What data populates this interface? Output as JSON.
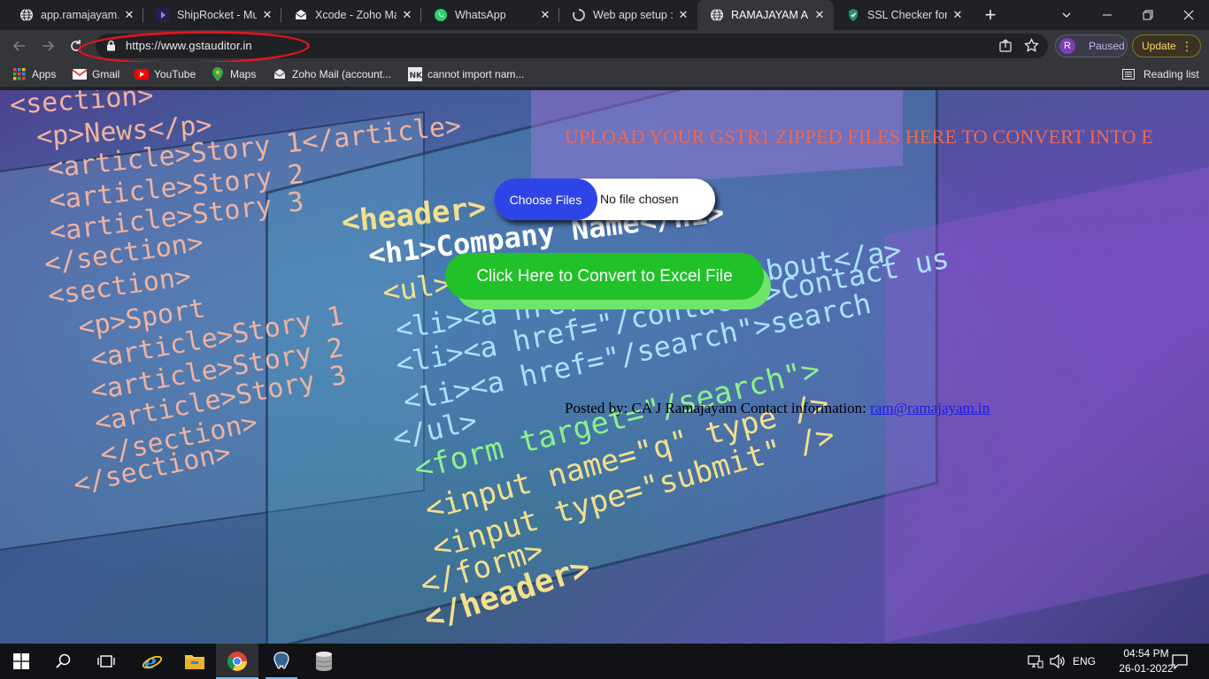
{
  "browser": {
    "tabs": [
      {
        "title": "app.ramajayam.in",
        "icon": "globe-icon",
        "active": false
      },
      {
        "title": "ShipRocket - Mul",
        "icon": "shiprocket-icon",
        "active": false
      },
      {
        "title": "Xcode - Zoho Ma",
        "icon": "zoho-mail-icon",
        "active": false
      },
      {
        "title": "WhatsApp",
        "icon": "whatsapp-icon",
        "active": false
      },
      {
        "title": "Web app setup :",
        "icon": "loading-icon",
        "active": false
      },
      {
        "title": "RAMAJAYAM AN",
        "icon": "globe-icon",
        "active": true
      },
      {
        "title": "SSL Checker for C",
        "icon": "ssl-checker-icon",
        "active": false
      }
    ],
    "new_tab_symbol": "+",
    "url": "https://www.gstauditor.in",
    "profile": {
      "initial": "R",
      "label": "Paused"
    },
    "update_label": "Update",
    "bookmarks": [
      {
        "label": "Apps",
        "icon": "apps-grid-icon"
      },
      {
        "label": "Gmail",
        "icon": "gmail-icon"
      },
      {
        "label": "YouTube",
        "icon": "youtube-icon"
      },
      {
        "label": "Maps",
        "icon": "maps-icon"
      },
      {
        "label": "Zoho Mail (account...",
        "icon": "zoho-mail-icon"
      },
      {
        "label": "cannot import nam...",
        "icon": "nk-icon"
      }
    ],
    "reading_list": "Reading list"
  },
  "page": {
    "heading": "UPLOAD YOUR GSTR1 ZIPPED FILES HERE TO CONVERT INTO E",
    "file_button": "Choose Files",
    "file_status": "No file chosen",
    "convert_button": "Click Here to Convert to Excel File",
    "posted_by": "Posted by: CA J Ramajayam Contact information: ",
    "email": "ram@ramajayam.in",
    "background_code": [
      "<section>",
      "<p>News</p>",
      "<article>Story 1</article>",
      "<article>Story 2",
      "<article>Story 3",
      "</section>",
      "<section>",
      "<p>Sport",
      "<article>Story 1",
      "<article>Story 2",
      "<article>Story 3",
      "</section>",
      "</section>",
      "<header>",
      "<h1>Company Name</h1>",
      "<ul>",
      "<li><a href=\"/about\">about</a>",
      "<li><a href=\"/contact\">Contact us",
      "<li><a href=\"/search\">search",
      "</ul>",
      "<form target=\"/search\">",
      "<input name=\"q\" type />",
      "<input type=\"submit\" />",
      "</form>",
      "</header>"
    ]
  },
  "taskbar": {
    "apps": [
      "windows-start-icon",
      "search-icon",
      "task-view-icon",
      "internet-explorer-icon",
      "file-explorer-icon",
      "chrome-icon",
      "postgresql-icon",
      "database-icon"
    ],
    "language": "ENG",
    "time": "04:54 PM",
    "date": "26-01-2022"
  },
  "colors": {
    "heading": "#ee6a51",
    "file_button": "#2d44e6",
    "convert_button": "#21c229",
    "convert_shadow": "#6ee56b",
    "url_highlight": "#e0141d",
    "link": "#1a1ae6"
  }
}
